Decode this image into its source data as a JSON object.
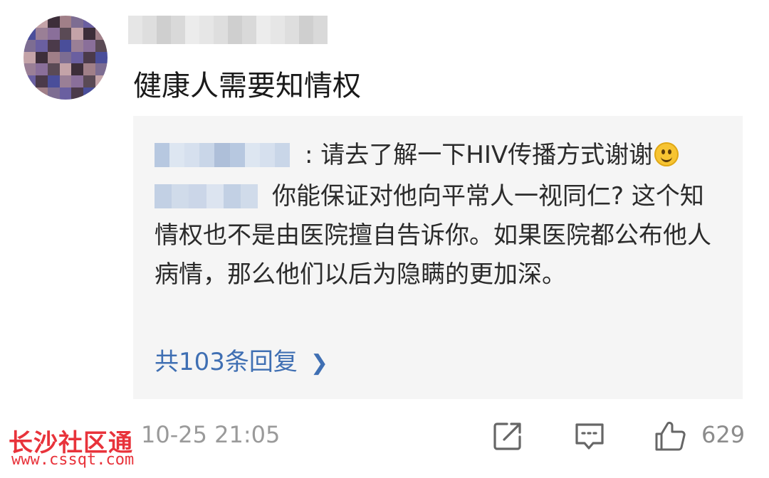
{
  "comment": {
    "text": "健康人需要知情权"
  },
  "replies": [
    {
      "text": ": 请去了解一下HIV传播方式谢谢",
      "emoji": "smile-icon"
    },
    {
      "text": "你能保证对他向平常人一视同仁? 这个知情权也不是由医院擅自告诉你。如果医院都公布他人病情，那么他们以后为隐瞒的更加深。"
    }
  ],
  "reply_count_label": "共103条回复",
  "footer": {
    "time": "10-25 21:05",
    "like_count": "629"
  },
  "icons": [
    "share-icon",
    "comment-icon",
    "like-icon",
    "chevron-right-icon"
  ],
  "watermark": {
    "title": "长沙社区通",
    "url": "www.cssqt.com"
  },
  "colors": {
    "link": "#3f6fb3",
    "reply_bg": "#f5f5f5",
    "meta": "#9a9a9a",
    "watermark": "#e8333b"
  }
}
